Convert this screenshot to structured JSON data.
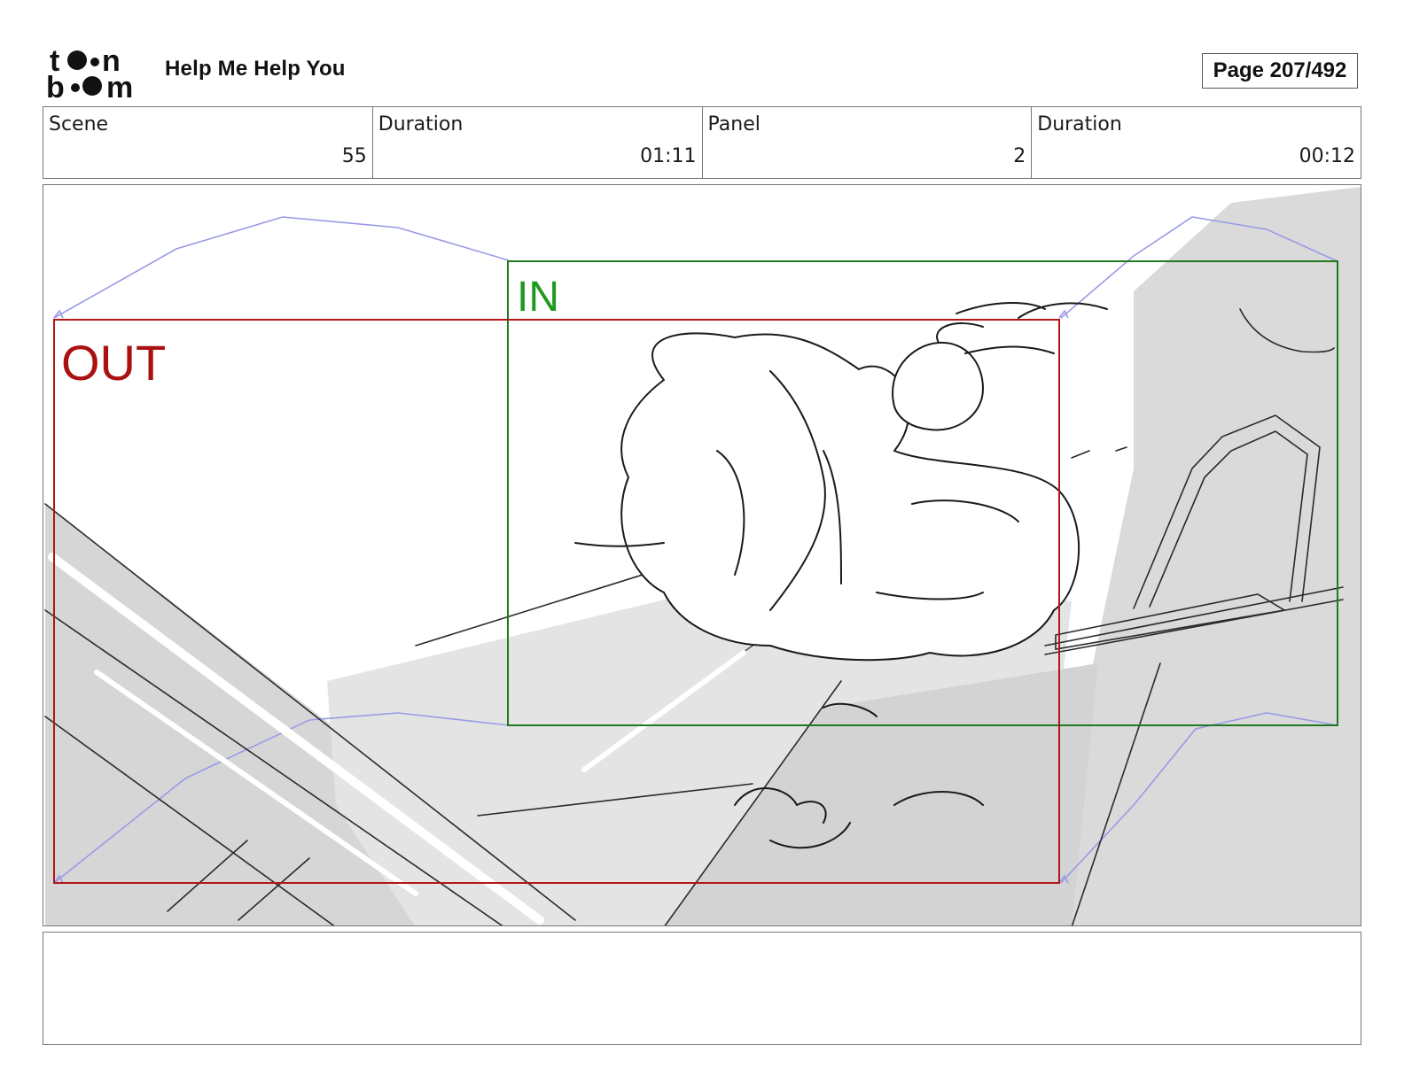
{
  "header": {
    "logo_text": "toon boom",
    "project_title": "Help Me Help You",
    "page_label": "Page 207/492"
  },
  "info": {
    "scene_label": "Scene",
    "scene_value": "55",
    "scene_duration_label": "Duration",
    "scene_duration_value": "01:11",
    "panel_label": "Panel",
    "panel_value": "2",
    "panel_duration_label": "Duration",
    "panel_duration_value": "00:12"
  },
  "panel": {
    "in_label": "IN",
    "out_label": "OUT",
    "colors": {
      "in_frame": "#1f7a1f",
      "out_frame": "#b01818",
      "camera_path": "#9a9ae8",
      "sketch": "#222222",
      "tone": "#dcdcdc"
    }
  },
  "notes": {
    "text": ""
  }
}
